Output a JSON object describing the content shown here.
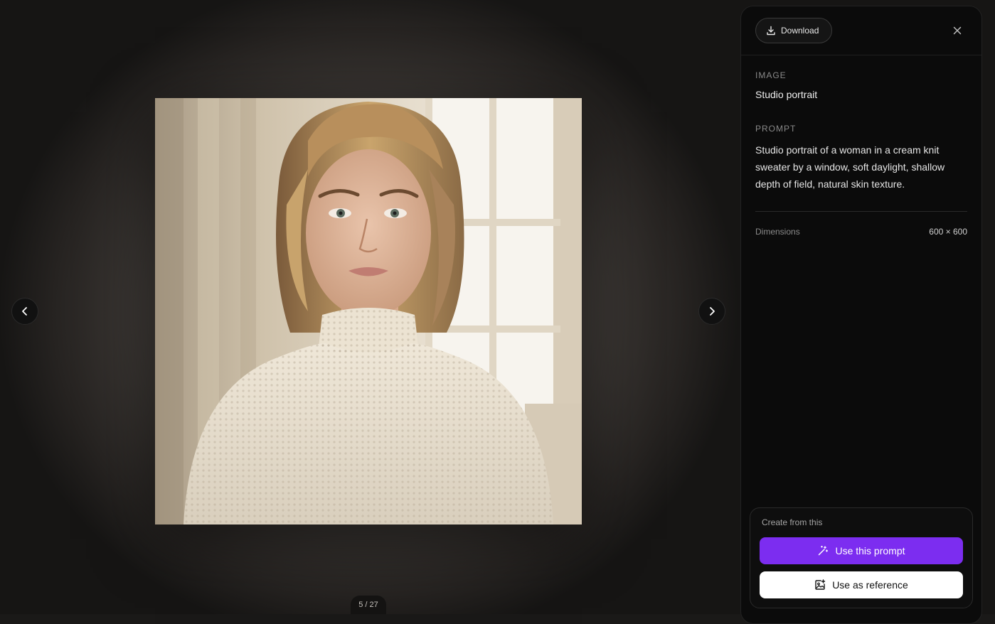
{
  "viewer": {
    "counter": "5 / 27",
    "photo_alt": "Portrait of a woman in a cream knit sweater by a window"
  },
  "panel": {
    "download_label": "Download",
    "image_section_label": "IMAGE",
    "image_title": "Studio portrait",
    "prompt_section_label": "PROMPT",
    "prompt_text": "Studio portrait of a woman in a cream knit sweater by a window, soft daylight, shallow depth of field, natural skin texture.",
    "dimensions_label": "Dimensions",
    "dimensions_value": "600 × 600"
  },
  "create": {
    "title": "Create from this",
    "use_prompt_label": "Use this prompt",
    "use_reference_label": "Use as reference"
  },
  "colors": {
    "accent": "#7c2df0",
    "panel_bg": "#0b0b0b"
  },
  "icons": {
    "download": "download-icon",
    "close": "close-icon",
    "prev": "chevron-left-icon",
    "next": "chevron-right-icon",
    "magic": "magic-wand-icon",
    "reference": "image-plus-icon"
  }
}
